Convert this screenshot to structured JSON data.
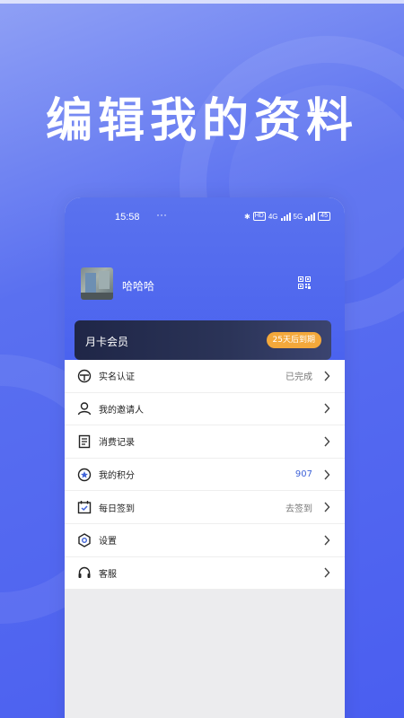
{
  "headline": "编辑我的资料",
  "status_bar": {
    "time": "15:58",
    "dots": "···",
    "network_hd": "HD",
    "network_4g": "4G",
    "network_5g": "5G",
    "battery": "45"
  },
  "profile": {
    "username": "哈哈哈"
  },
  "membership": {
    "label": "月卡会员",
    "expiry": "25天后到期"
  },
  "menu": [
    {
      "label": "实名认证",
      "value": "已完成",
      "icon": "shield-icon"
    },
    {
      "label": "我的邀请人",
      "value": "",
      "icon": "person-icon"
    },
    {
      "label": "消费记录",
      "value": "",
      "icon": "receipt-icon"
    },
    {
      "label": "我的积分",
      "value": "907",
      "icon": "star-badge-icon"
    },
    {
      "label": "每日签到",
      "value": "去签到",
      "icon": "calendar-check-icon"
    },
    {
      "label": "设置",
      "value": "",
      "icon": "gear-icon"
    },
    {
      "label": "客服",
      "value": "",
      "icon": "headset-icon"
    }
  ],
  "colors": {
    "accent": "#4961ef",
    "badge": "#f3a83b",
    "points": "#3f63d8"
  }
}
